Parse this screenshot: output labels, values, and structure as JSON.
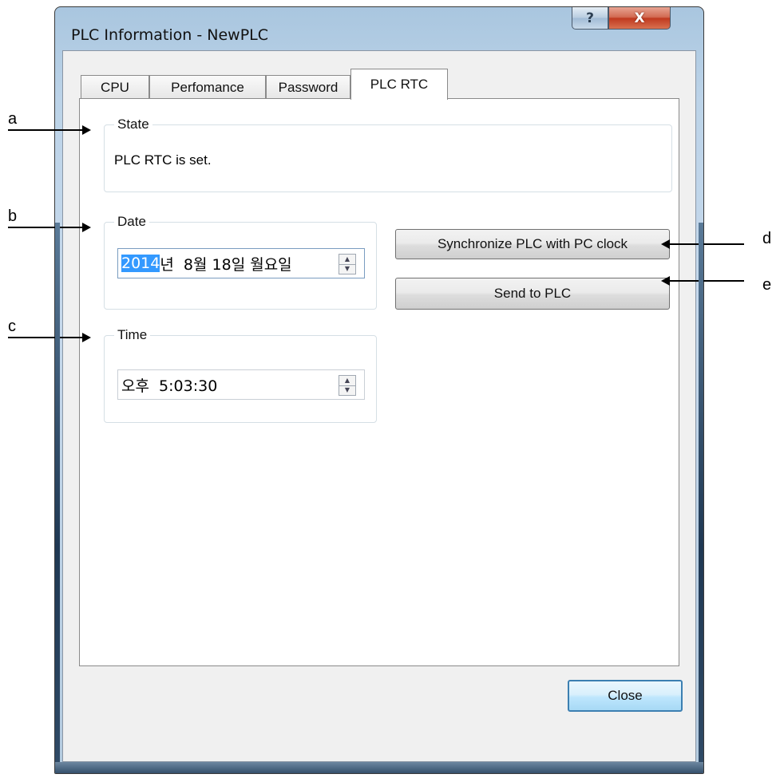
{
  "window": {
    "title": "PLC Information - NewPLC",
    "help_label": "?",
    "close_glyph": "X"
  },
  "tabs": [
    {
      "label": "CPU"
    },
    {
      "label": "Perfomance"
    },
    {
      "label": "Password"
    },
    {
      "label": "PLC RTC"
    }
  ],
  "active_tab": "PLC RTC",
  "state": {
    "title": "State",
    "text": "PLC RTC is set."
  },
  "date": {
    "title": "Date",
    "year_selected": "2014",
    "rest": "년  8월 18일 월요일"
  },
  "time": {
    "title": "Time",
    "value": "오후  5:03:30"
  },
  "buttons": {
    "sync": "Synchronize PLC with PC clock",
    "send": "Send to PLC",
    "close": "Close"
  },
  "annotations": {
    "a": "a",
    "b": "b",
    "c": "c",
    "d": "d",
    "e": "e"
  },
  "icons": {
    "spin_up": "▲",
    "spin_down": "▼"
  }
}
